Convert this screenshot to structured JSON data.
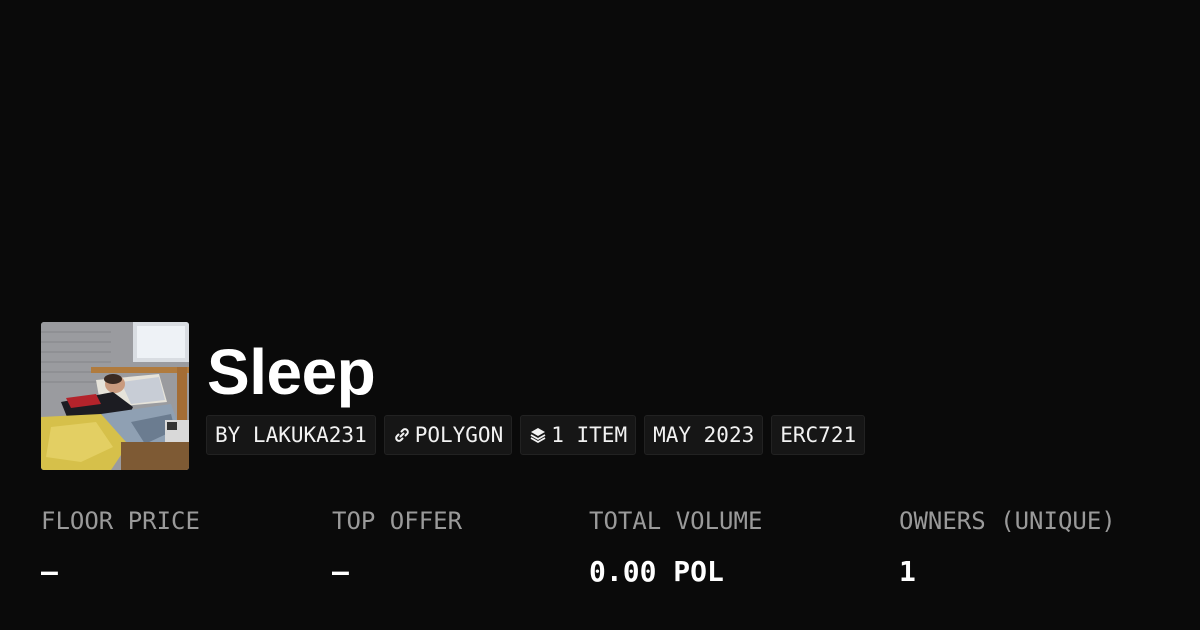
{
  "collection": {
    "title": "Sleep",
    "thumbnail_alt": "person sleeping in bed"
  },
  "tags": {
    "creator": "BY LAKUKA231",
    "chain": "POLYGON",
    "chain_icon": "link-icon",
    "items": "1 ITEM",
    "items_icon": "layers-icon",
    "date": "MAY 2023",
    "standard": "ERC721"
  },
  "stats": {
    "floor_price": {
      "label": "FLOOR PRICE",
      "value": "—"
    },
    "top_offer": {
      "label": "TOP OFFER",
      "value": "—"
    },
    "total_volume": {
      "label": "TOTAL VOLUME",
      "value": "0.00 POL"
    },
    "owners": {
      "label": "OWNERS (UNIQUE)",
      "value": "1"
    }
  },
  "colors": {
    "background": "#0a0a0a",
    "tag_background": "#161616",
    "label_gray": "#9a9a9a",
    "text_white": "#ffffff"
  }
}
